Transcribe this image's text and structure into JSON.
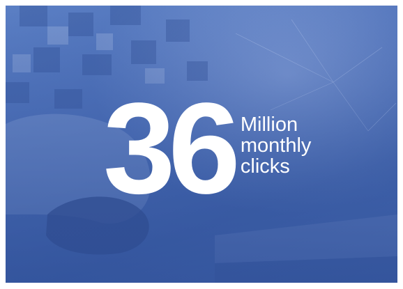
{
  "stat": {
    "value": "36",
    "caption_lines": [
      "Million",
      "monthly",
      "clicks"
    ]
  },
  "background": {
    "photo": "hand-on-computer-mouse-with-laptop",
    "tint_color": "#4a6db6"
  }
}
